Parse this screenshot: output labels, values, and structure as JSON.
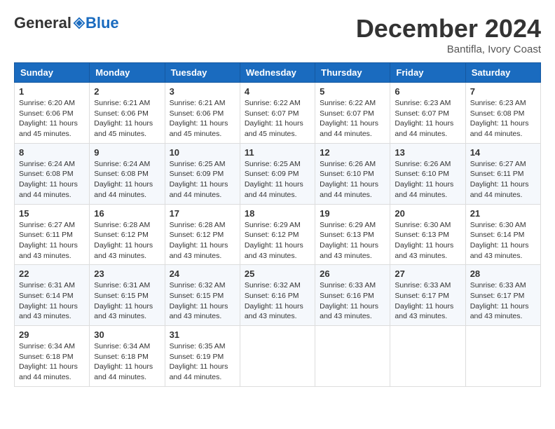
{
  "header": {
    "logo_general": "General",
    "logo_blue": "Blue",
    "month_title": "December 2024",
    "location": "Bantifla, Ivory Coast"
  },
  "days_of_week": [
    "Sunday",
    "Monday",
    "Tuesday",
    "Wednesday",
    "Thursday",
    "Friday",
    "Saturday"
  ],
  "weeks": [
    [
      {
        "day": 1,
        "info": "Sunrise: 6:20 AM\nSunset: 6:06 PM\nDaylight: 11 hours\nand 45 minutes."
      },
      {
        "day": 2,
        "info": "Sunrise: 6:21 AM\nSunset: 6:06 PM\nDaylight: 11 hours\nand 45 minutes."
      },
      {
        "day": 3,
        "info": "Sunrise: 6:21 AM\nSunset: 6:06 PM\nDaylight: 11 hours\nand 45 minutes."
      },
      {
        "day": 4,
        "info": "Sunrise: 6:22 AM\nSunset: 6:07 PM\nDaylight: 11 hours\nand 45 minutes."
      },
      {
        "day": 5,
        "info": "Sunrise: 6:22 AM\nSunset: 6:07 PM\nDaylight: 11 hours\nand 44 minutes."
      },
      {
        "day": 6,
        "info": "Sunrise: 6:23 AM\nSunset: 6:07 PM\nDaylight: 11 hours\nand 44 minutes."
      },
      {
        "day": 7,
        "info": "Sunrise: 6:23 AM\nSunset: 6:08 PM\nDaylight: 11 hours\nand 44 minutes."
      }
    ],
    [
      {
        "day": 8,
        "info": "Sunrise: 6:24 AM\nSunset: 6:08 PM\nDaylight: 11 hours\nand 44 minutes."
      },
      {
        "day": 9,
        "info": "Sunrise: 6:24 AM\nSunset: 6:08 PM\nDaylight: 11 hours\nand 44 minutes."
      },
      {
        "day": 10,
        "info": "Sunrise: 6:25 AM\nSunset: 6:09 PM\nDaylight: 11 hours\nand 44 minutes."
      },
      {
        "day": 11,
        "info": "Sunrise: 6:25 AM\nSunset: 6:09 PM\nDaylight: 11 hours\nand 44 minutes."
      },
      {
        "day": 12,
        "info": "Sunrise: 6:26 AM\nSunset: 6:10 PM\nDaylight: 11 hours\nand 44 minutes."
      },
      {
        "day": 13,
        "info": "Sunrise: 6:26 AM\nSunset: 6:10 PM\nDaylight: 11 hours\nand 44 minutes."
      },
      {
        "day": 14,
        "info": "Sunrise: 6:27 AM\nSunset: 6:11 PM\nDaylight: 11 hours\nand 44 minutes."
      }
    ],
    [
      {
        "day": 15,
        "info": "Sunrise: 6:27 AM\nSunset: 6:11 PM\nDaylight: 11 hours\nand 43 minutes."
      },
      {
        "day": 16,
        "info": "Sunrise: 6:28 AM\nSunset: 6:12 PM\nDaylight: 11 hours\nand 43 minutes."
      },
      {
        "day": 17,
        "info": "Sunrise: 6:28 AM\nSunset: 6:12 PM\nDaylight: 11 hours\nand 43 minutes."
      },
      {
        "day": 18,
        "info": "Sunrise: 6:29 AM\nSunset: 6:12 PM\nDaylight: 11 hours\nand 43 minutes."
      },
      {
        "day": 19,
        "info": "Sunrise: 6:29 AM\nSunset: 6:13 PM\nDaylight: 11 hours\nand 43 minutes."
      },
      {
        "day": 20,
        "info": "Sunrise: 6:30 AM\nSunset: 6:13 PM\nDaylight: 11 hours\nand 43 minutes."
      },
      {
        "day": 21,
        "info": "Sunrise: 6:30 AM\nSunset: 6:14 PM\nDaylight: 11 hours\nand 43 minutes."
      }
    ],
    [
      {
        "day": 22,
        "info": "Sunrise: 6:31 AM\nSunset: 6:14 PM\nDaylight: 11 hours\nand 43 minutes."
      },
      {
        "day": 23,
        "info": "Sunrise: 6:31 AM\nSunset: 6:15 PM\nDaylight: 11 hours\nand 43 minutes."
      },
      {
        "day": 24,
        "info": "Sunrise: 6:32 AM\nSunset: 6:15 PM\nDaylight: 11 hours\nand 43 minutes."
      },
      {
        "day": 25,
        "info": "Sunrise: 6:32 AM\nSunset: 6:16 PM\nDaylight: 11 hours\nand 43 minutes."
      },
      {
        "day": 26,
        "info": "Sunrise: 6:33 AM\nSunset: 6:16 PM\nDaylight: 11 hours\nand 43 minutes."
      },
      {
        "day": 27,
        "info": "Sunrise: 6:33 AM\nSunset: 6:17 PM\nDaylight: 11 hours\nand 43 minutes."
      },
      {
        "day": 28,
        "info": "Sunrise: 6:33 AM\nSunset: 6:17 PM\nDaylight: 11 hours\nand 43 minutes."
      }
    ],
    [
      {
        "day": 29,
        "info": "Sunrise: 6:34 AM\nSunset: 6:18 PM\nDaylight: 11 hours\nand 44 minutes."
      },
      {
        "day": 30,
        "info": "Sunrise: 6:34 AM\nSunset: 6:18 PM\nDaylight: 11 hours\nand 44 minutes."
      },
      {
        "day": 31,
        "info": "Sunrise: 6:35 AM\nSunset: 6:19 PM\nDaylight: 11 hours\nand 44 minutes."
      },
      null,
      null,
      null,
      null
    ]
  ]
}
